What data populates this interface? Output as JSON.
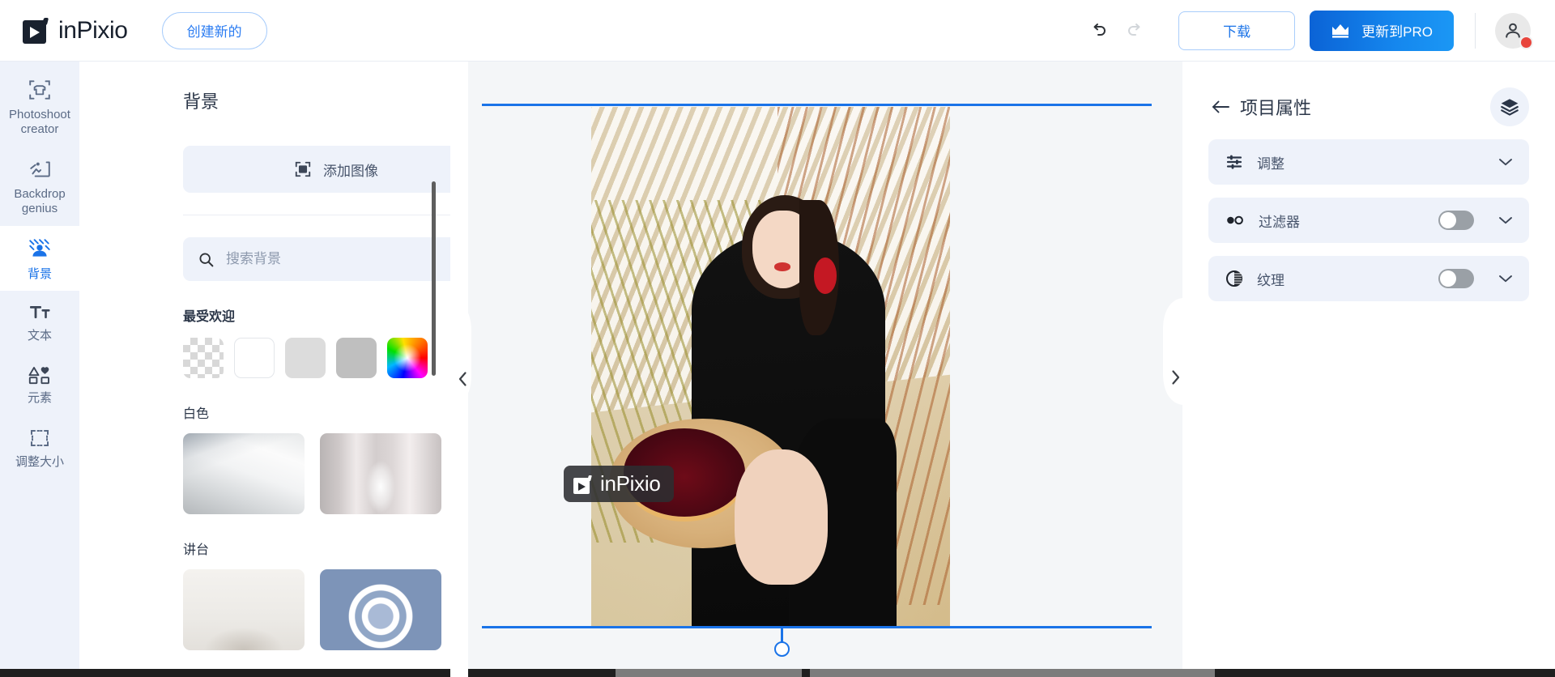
{
  "header": {
    "brand_name": "inPixio",
    "create_new_label": "创建新的",
    "undo_icon": "undo-icon",
    "redo_icon": "redo-icon",
    "download_label": "下载",
    "pro_label": "更新到PRO",
    "pro_icon": "crown-icon",
    "avatar_icon": "user-avatar-icon",
    "avatar_badge_color": "#e8453c",
    "accent_color": "#1a73e8"
  },
  "rail": {
    "items": [
      {
        "label": "Photoshoot\ncreator",
        "icon": "tshirt-frame-icon",
        "active": false
      },
      {
        "label": "Backdrop\ngenius",
        "icon": "backdrop-person-icon",
        "active": false
      },
      {
        "label": "背景",
        "icon": "background-person-icon",
        "active": true
      },
      {
        "label": "文本",
        "icon": "text-tt-icon",
        "active": false
      },
      {
        "label": "元素",
        "icon": "shapes-elements-icon",
        "active": false
      },
      {
        "label": "调整大小",
        "icon": "resize-crop-icon",
        "active": false
      }
    ]
  },
  "left_panel": {
    "title": "背景",
    "add_image_label": "添加图像",
    "add_image_icon": "image-placeholder-icon",
    "search_placeholder": "搜索背景",
    "search_value": "",
    "search_icon": "search-icon",
    "filter_icon": "filter-funnel-icon",
    "popular_heading": "最受欢迎",
    "swatches": [
      {
        "name": "transparent",
        "color": "transparent"
      },
      {
        "name": "white",
        "color": "#ffffff"
      },
      {
        "name": "light-gray",
        "color": "#dcdcdc"
      },
      {
        "name": "gray",
        "color": "#bfbfbf"
      },
      {
        "name": "color-picker",
        "color": "rainbow"
      }
    ],
    "add_swatch_label": "+",
    "sections": [
      {
        "heading": "白色",
        "thumbs": [
          "dune",
          "arch"
        ]
      },
      {
        "heading": "讲台",
        "thumbs": [
          "podium1",
          "podium2"
        ]
      }
    ],
    "collapse_icon": "chevron-left-icon"
  },
  "canvas": {
    "watermark_text": "inPixio",
    "guide_color": "#1a73e8",
    "expand_icon": "chevron-right-icon"
  },
  "right_panel": {
    "back_icon": "arrow-left-icon",
    "title": "项目属性",
    "layers_icon": "layers-icon",
    "rows": [
      {
        "label": "调整",
        "icon": "sliders-icon",
        "has_toggle": false,
        "toggle_on": false,
        "chevron": "chevron-down-icon"
      },
      {
        "label": "过滤器",
        "icon": "filters-circles-icon",
        "has_toggle": true,
        "toggle_on": false,
        "chevron": "chevron-down-icon"
      },
      {
        "label": "纹理",
        "icon": "texture-contrast-icon",
        "has_toggle": true,
        "toggle_on": false,
        "chevron": "chevron-down-icon"
      }
    ]
  }
}
